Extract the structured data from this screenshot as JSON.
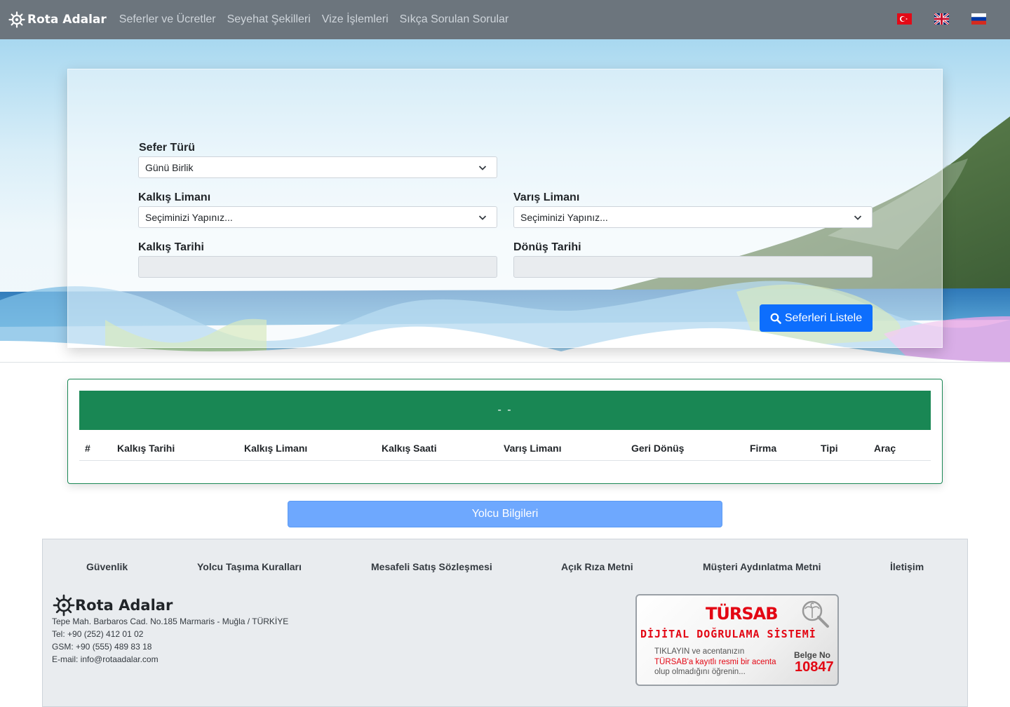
{
  "navbar": {
    "brand": "Rota Adalar",
    "links": [
      "Seferler ve Ücretler",
      "Seyehat Şekilleri",
      "Vize İşlemleri",
      "Sıkça Sorulan Sorular"
    ],
    "languages": [
      "tr-flag",
      "uk-flag",
      "ru-flag"
    ]
  },
  "search": {
    "trip_type_label": "Sefer Türü",
    "trip_type_value": "Günü Birlik",
    "departure_port_label": "Kalkış Limanı",
    "departure_port_value": "Seçiminizi Yapınız...",
    "arrival_port_label": "Varış Limanı",
    "arrival_port_value": "Seçiminizi Yapınız...",
    "departure_date_label": "Kalkış Tarihi",
    "departure_date_value": "",
    "return_date_label": "Dönüş Tarihi",
    "return_date_value": "",
    "submit_label": "Seferleri Listele"
  },
  "results": {
    "header": "- -",
    "columns": [
      "#",
      "Kalkış Tarihi",
      "Kalkış Limanı",
      "Kalkış Saati",
      "Varış Limanı",
      "Geri Dönüş",
      "Firma",
      "Tipi",
      "Araç"
    ]
  },
  "passenger_button": "Yolcu Bilgileri",
  "footer": {
    "links": [
      "Güvenlik",
      "Yolcu Taşıma Kuralları",
      "Mesafeli Satış Sözleşmesi",
      "Açık Rıza Metni",
      "Müşteri Aydınlatma Metni",
      "İletişim"
    ],
    "brand": "Rota Adalar",
    "address": "Tepe Mah. Barbaros Cad. No.185 Marmaris - Muğla / TÜRKİYE",
    "tel": "Tel: +90 (252) 412 01 02",
    "gsm": "GSM: +90 (555) 489 83 18",
    "email": "E-mail: info@rotaadalar.com"
  },
  "tursab": {
    "logo": "TÜRSAB",
    "subtitle": "DİJİTAL DOĞRULAMA SİSTEMİ",
    "line1": "TIKLAYIN ve acentanızın",
    "line2": "TÜRSAB'a kayıtlı resmi bir acenta",
    "line3": "olup olmadığını öğrenin...",
    "belge_label": "Belge No",
    "belge_no": "10847"
  },
  "colors": {
    "navbar": "#6c757d",
    "primary": "#0d6efd",
    "success": "#198754",
    "tursab_red": "#e30613"
  }
}
